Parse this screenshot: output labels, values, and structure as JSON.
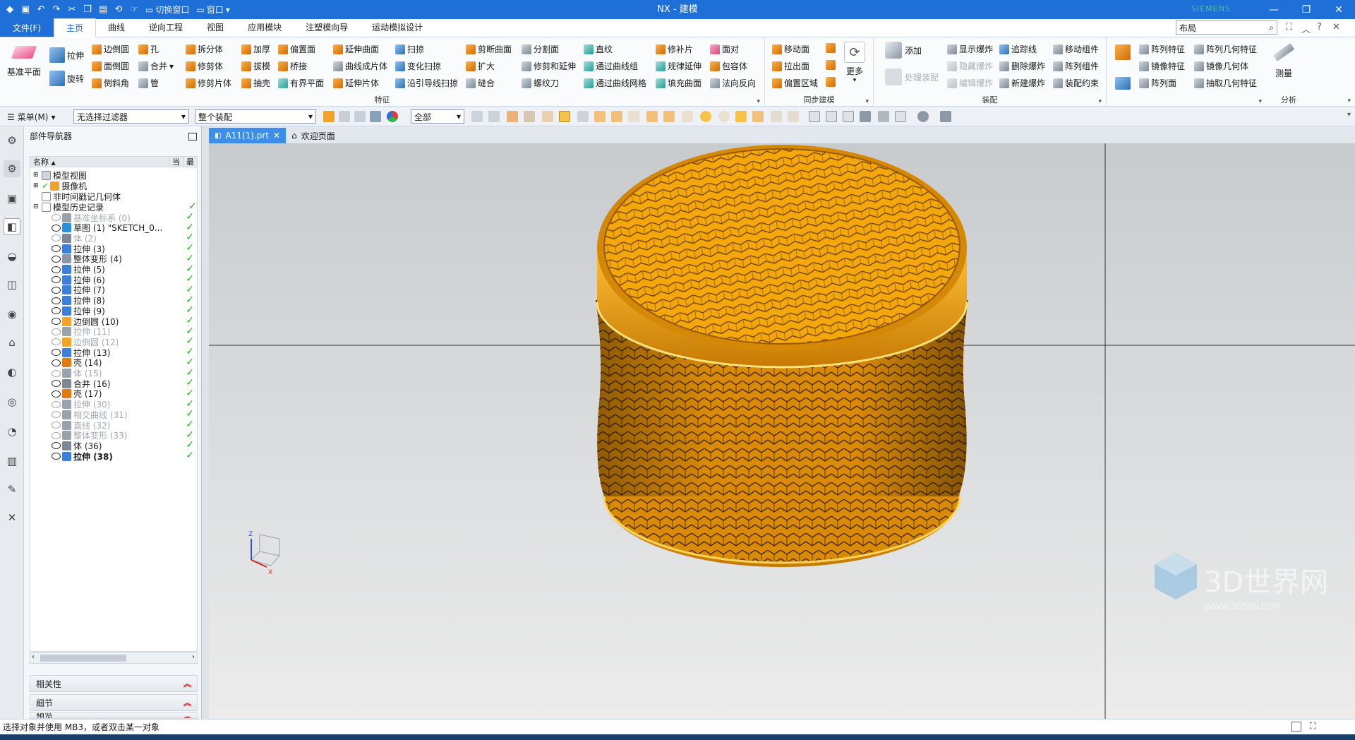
{
  "app": {
    "title": "NX - 建模",
    "brand": "SIEMENS",
    "qat_switch_window": "切换窗口",
    "qat_window": "窗口"
  },
  "menu": {
    "file": "文件(F)",
    "tabs": [
      "主页",
      "曲线",
      "逆向工程",
      "视图",
      "应用模块",
      "注塑模向导",
      "运动模拟设计"
    ],
    "search_value": "布局"
  },
  "ribbon": {
    "big": {
      "datum_plane": "基准平面",
      "extrude": "拉伸",
      "revolve": "旋转",
      "more": "更多",
      "add": "添加",
      "process_assembly": "处理装配",
      "measure": "测量"
    },
    "feature": {
      "col1": [
        "边倒圆",
        "面倒圆",
        "倒斜角"
      ],
      "col2": [
        "孔",
        "合并",
        "管"
      ],
      "col3": [
        "拆分体",
        "修剪体",
        "修剪片体"
      ],
      "col4": [
        "加厚",
        "拔模",
        "抽壳"
      ],
      "col5": [
        "偏置面",
        "桥接",
        "有界平面"
      ],
      "col6": [
        "延伸曲面",
        "曲线成片体",
        "延伸片体"
      ],
      "col7": [
        "扫掠",
        "变化扫掠",
        "沿引导线扫掠"
      ],
      "col8": [
        "剪断曲面",
        "扩大",
        "缝合"
      ],
      "col9": [
        "分割面",
        "修剪和延伸",
        "螺纹刀"
      ],
      "col10": [
        "直纹",
        "通过曲线组",
        "通过曲线网格"
      ],
      "col11": [
        "修补片",
        "规律延伸",
        "填充曲面"
      ],
      "col12": [
        "面对",
        "包容体",
        "法向反向"
      ],
      "label": "特征"
    },
    "sync": {
      "items": [
        "移动面",
        "拉出面",
        "偏置区域"
      ],
      "label": "同步建模"
    },
    "assembly": {
      "col1": [
        "显示爆炸",
        "隐藏爆炸",
        "编辑爆炸"
      ],
      "col2": [
        "追踪线",
        "删除爆炸",
        "新建爆炸"
      ],
      "col3": [
        "移动组件",
        "阵列组件",
        "装配约束"
      ],
      "label": "装配"
    },
    "pattern": {
      "col1": [
        "阵列特征",
        "镜像特征",
        "阵列面"
      ],
      "col2": [
        "阵列几何特征",
        "镜像几何体",
        "抽取几何特征"
      ]
    },
    "analysis": {
      "label": "分析"
    }
  },
  "toolbar": {
    "menu_label": "菜单(M)",
    "filter": "无选择过滤器",
    "assembly_scope": "整个装配",
    "layer": "全部"
  },
  "navigator": {
    "title": "部件导航器",
    "col_name": "名称",
    "col_current": "当",
    "col_latest": "最",
    "top_items": [
      "模型视图",
      "摄像机",
      "非时间戳记几何体",
      "模型历史记录"
    ],
    "features": [
      {
        "label": "基准坐标系 (0)",
        "dim": true
      },
      {
        "label": "草图 (1) \"SKETCH_0...",
        "dim": false
      },
      {
        "label": "体 (2)",
        "dim": true
      },
      {
        "label": "拉伸 (3)",
        "dim": false
      },
      {
        "label": "整体变形 (4)",
        "dim": false
      },
      {
        "label": "拉伸 (5)",
        "dim": false
      },
      {
        "label": "拉伸 (6)",
        "dim": false
      },
      {
        "label": "拉伸 (7)",
        "dim": false
      },
      {
        "label": "拉伸 (8)",
        "dim": false
      },
      {
        "label": "拉伸 (9)",
        "dim": false
      },
      {
        "label": "边倒圆 (10)",
        "dim": false
      },
      {
        "label": "拉伸 (11)",
        "dim": true
      },
      {
        "label": "边倒圆 (12)",
        "dim": true
      },
      {
        "label": "拉伸 (13)",
        "dim": false
      },
      {
        "label": "壳 (14)",
        "dim": false
      },
      {
        "label": "体 (15)",
        "dim": true
      },
      {
        "label": "合并 (16)",
        "dim": false
      },
      {
        "label": "壳 (17)",
        "dim": false
      },
      {
        "label": "拉伸 (30)",
        "dim": true
      },
      {
        "label": "相交曲线 (31)",
        "dim": true
      },
      {
        "label": "直线 (32)",
        "dim": true
      },
      {
        "label": "整体变形 (33)",
        "dim": true
      },
      {
        "label": "体 (36)",
        "dim": false
      },
      {
        "label": "拉伸 (38)",
        "dim": false
      }
    ],
    "panels": [
      "相关性",
      "细节",
      "预览"
    ]
  },
  "tabs": {
    "part": "A11(1).prt",
    "welcome": "欢迎页面"
  },
  "status": {
    "prompt": "选择对象并使用 MB3，或者双击某一对象"
  },
  "watermark": {
    "text": "3D世界网",
    "url": "WWW.3DSJW.COM"
  },
  "colors": {
    "accent": "#1e6fd8",
    "basket": "#f2a60c",
    "check": "#1fb51f"
  }
}
